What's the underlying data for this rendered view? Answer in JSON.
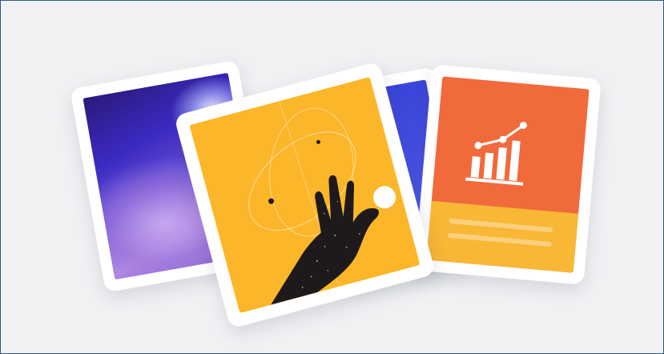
{
  "illustration": {
    "cards": [
      {
        "name": "abstract-gradient",
        "colors": [
          "#2a1a7a",
          "#3b2ac2",
          "#b58ee6"
        ]
      },
      {
        "name": "blue-pie",
        "colors": [
          "#3742d6",
          "#ffffff"
        ]
      },
      {
        "name": "hand",
        "colors": [
          "#fcb62a",
          "#1e1a1c",
          "#ffffff"
        ]
      },
      {
        "name": "bar-chart",
        "colors": [
          "#f16a3c",
          "#f9b736",
          "#ffffff"
        ]
      }
    ],
    "chart_icon": {
      "bars": 4,
      "trend": "up"
    },
    "background": "#f0f1f3",
    "border": "#2d5b8a"
  }
}
